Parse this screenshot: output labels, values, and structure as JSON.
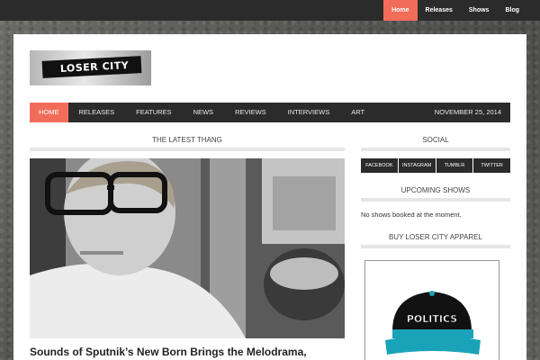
{
  "topbar": {
    "items": [
      {
        "label": "Home",
        "active": true
      },
      {
        "label": "Releases"
      },
      {
        "label": "Shows"
      },
      {
        "label": "Blog"
      }
    ]
  },
  "logo": {
    "text": "LOSER CITY"
  },
  "mainnav": {
    "items": [
      "HOME",
      "RELEASES",
      "FEATURES",
      "NEWS",
      "REVIEWS",
      "INTERVIEWS",
      "ART"
    ],
    "date": "NOVEMBER 25, 2014"
  },
  "main": {
    "section_title": "THE LATEST THANG",
    "feature_title": "Sounds of Sputnik’s New Born Brings the Melodrama,"
  },
  "sidebar": {
    "social_title": "SOCIAL",
    "social_links": [
      "FACEBOOK",
      "INSTAGRAM",
      "TUMBLR",
      "TWITTER"
    ],
    "shows_title": "UPCOMING SHOWS",
    "shows_text": "No shows booked at the moment.",
    "apparel_title": "BUY LOSER CITY APPAREL",
    "cap_text": "POLITICS"
  },
  "colors": {
    "accent": "#f26c5a",
    "dark": "#2b2b2b",
    "cap_teal": "#1aa3b8"
  }
}
